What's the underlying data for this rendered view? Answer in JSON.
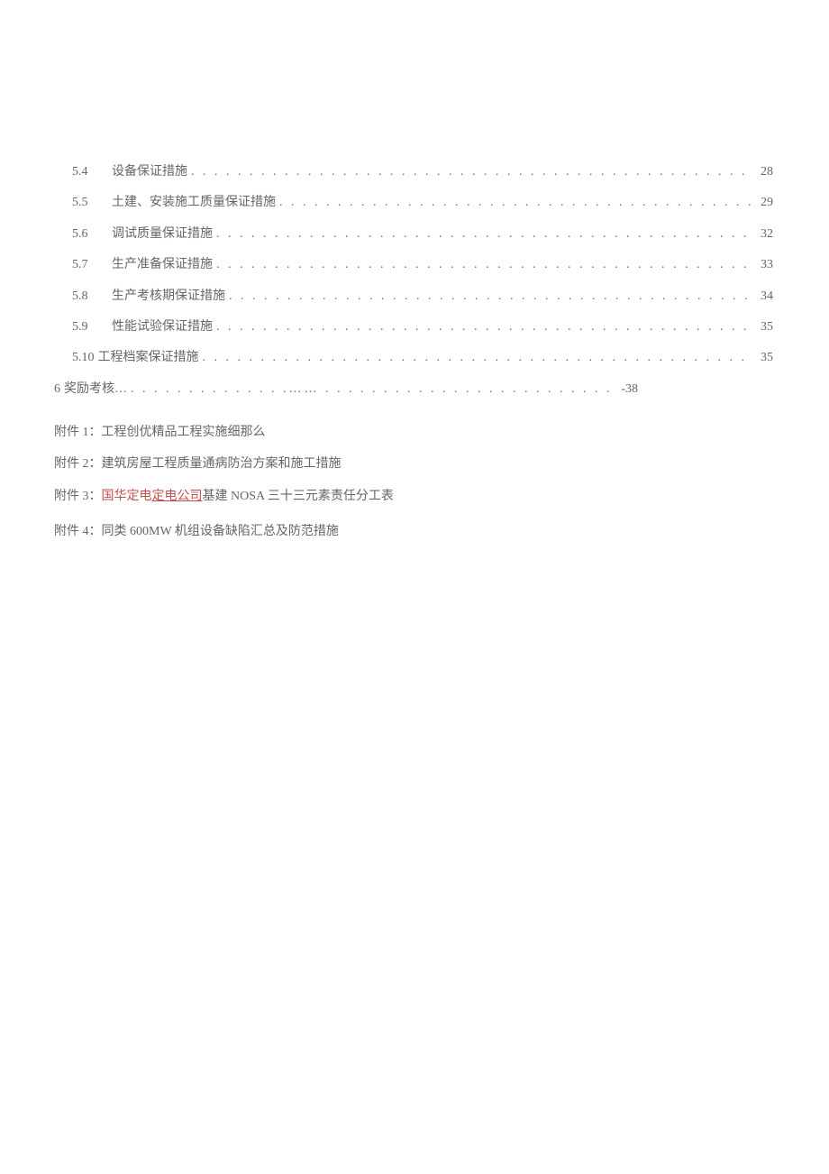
{
  "toc": [
    {
      "num": "5.4",
      "title": "设备保证措施",
      "page": "28"
    },
    {
      "num": "5.5",
      "title": "土建、安装施工质量保证措施",
      "page": "29"
    },
    {
      "num": "5.6",
      "title": "调试质量保证措施",
      "page": "32"
    },
    {
      "num": "5.7",
      "title": "生产准备保证措施",
      "page": "33"
    },
    {
      "num": "5.8",
      "title": "生产考核期保证措施",
      "page": "34"
    },
    {
      "num": "5.9",
      "title": "性能试验保证措施",
      "page": "35"
    }
  ],
  "toc510": {
    "num": "5.10",
    "title": "工程档案保证措施",
    "page": "35"
  },
  "toc6": {
    "num": "6",
    "title": "奖励考核…",
    "page": "-38"
  },
  "dots": ". . . . . . . . . . . . . . . . . . . . . . . . . . . . . . . . . . . . . . . . . . . . . . . . . . . . . . . . . . . . . . . . . . . . . . . . . . . . . . . . . . . . . . . . . . . . . .",
  "dots_mixed": ". . . . . . . . . . . . . .…… . . . .  . . . . . . . . . . . . . . . . . . . . . . . . . . . . . . . . . .",
  "appendix": {
    "a1_label": "附件 1：",
    "a1_text": "工程创优精品工程实施细那么",
    "a2_label": "附件 2：",
    "a2_text": "建筑房屋工程质量通病防治方案和施工措施",
    "a3_label": "附件 3：",
    "a3_red": "国华定电",
    "a3_underline": "定电公司",
    "a3_rest": "基建 NOSA 三十三元素责任分工表",
    "a4_label": "附件 4：",
    "a4_text": "同类 600MW 机组设备缺陷汇总及防范措施"
  }
}
